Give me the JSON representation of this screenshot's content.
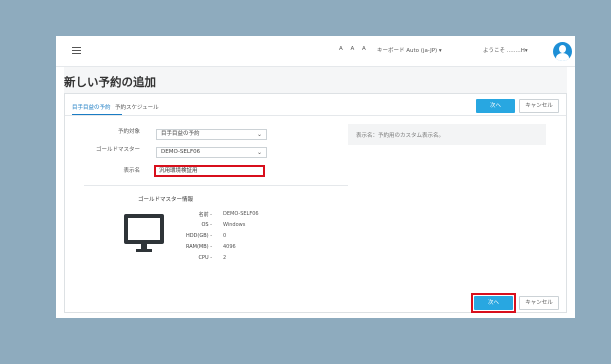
{
  "header": {
    "font_size_controls": "A A A",
    "keyboard_label": "キーボード Auto (ja-JP) ▾",
    "welcome_text": "ようこそ ........H▾"
  },
  "page": {
    "title": "新しい予約の追加"
  },
  "tabs": [
    {
      "label": "目手目益の予約",
      "active": true
    },
    {
      "label": "予約スケジュール",
      "active": false
    }
  ],
  "buttons": {
    "next_top": "次へ",
    "cancel_top": "キャンセル",
    "next_bottom": "次へ",
    "cancel_bottom": "キャンセル"
  },
  "form": {
    "target_label": "予約対象",
    "target_value": "目手目益の予約",
    "master_label": "ゴールドマスター",
    "master_value": "DEMO-SELF06",
    "display_label": "表示名",
    "display_value": "汎用環境検証用"
  },
  "info_panel": {
    "text": "表示名：予約用のカスタム表示名。"
  },
  "gold_master_info": {
    "title": "ゴールドマスター情報",
    "specs": [
      {
        "key": "名前 -",
        "value": "DEMO-SELF06"
      },
      {
        "key": "OS -",
        "value": "Windows"
      },
      {
        "key": "HDD(GB) -",
        "value": "0"
      },
      {
        "key": "RAM(MB) -",
        "value": "4096"
      },
      {
        "key": "CPU -",
        "value": "2"
      }
    ]
  },
  "colors": {
    "background": "#8eabbe",
    "accent": "#28a7e1",
    "highlight": "#d80f1c"
  },
  "icons": {
    "menu": "hamburger-icon",
    "avatar": "user-avatar-icon",
    "dropdown": "chevron-down-icon",
    "machine": "monitor-icon"
  }
}
